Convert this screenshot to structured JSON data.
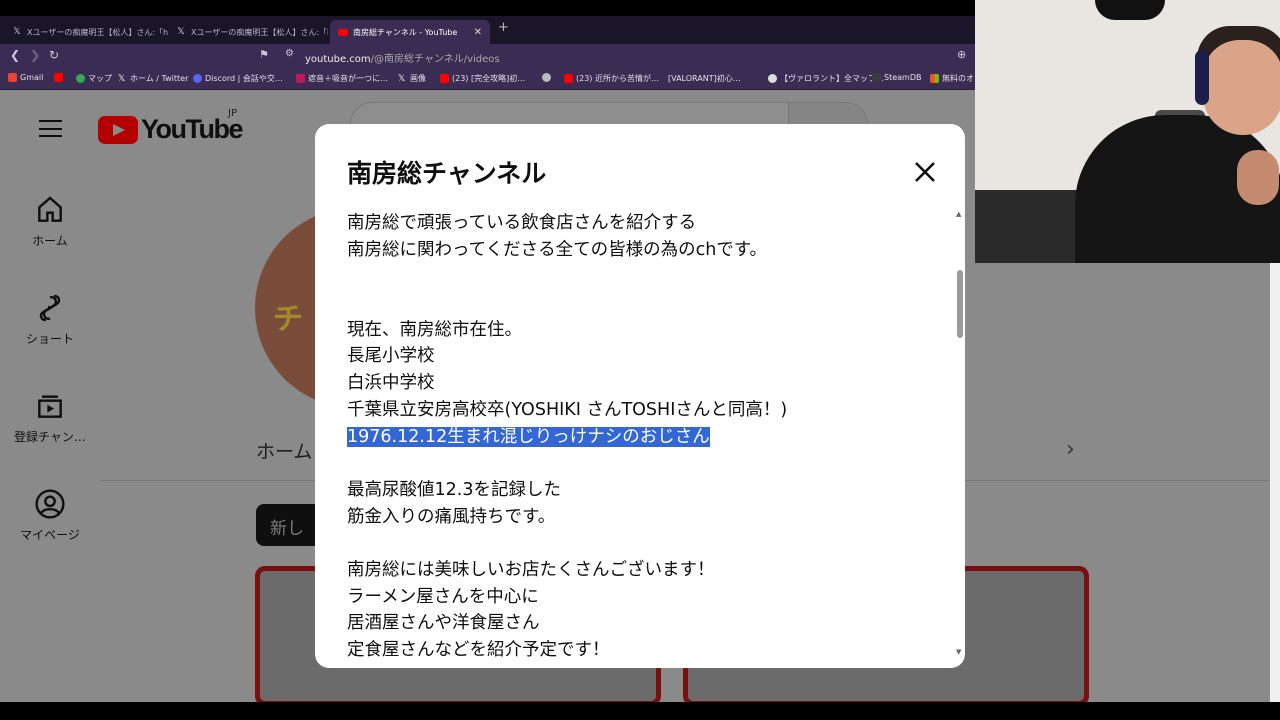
{
  "browser": {
    "tabs": [
      {
        "label": "Xユーザーの痴魔明王【松人】さん:「https:"
      },
      {
        "label": "Xユーザーの痴魔明王【松人】さん:「https:"
      },
      {
        "label": "南房総チャンネル - YouTube"
      }
    ],
    "new_tab": "+",
    "url_host": "youtube.com",
    "url_path": "/@南房総チャンネル/videos",
    "bookmarks": [
      {
        "label": "Gmail"
      },
      {
        "label": ""
      },
      {
        "label": "マップ"
      },
      {
        "label": "ホーム / Twitter"
      },
      {
        "label": "Discord | 会話や交…"
      },
      {
        "label": "遮音＋吸音が一つに…"
      },
      {
        "label": "画像"
      },
      {
        "label": "(23) [完全攻略]初…"
      },
      {
        "label": ""
      },
      {
        "label": "(23) 近所から苦情が…"
      },
      {
        "label": "[VALORANT]初心…"
      },
      {
        "label": "【ヴァロラント】全マップ…"
      },
      {
        "label": "SteamDB"
      },
      {
        "label": "無料のオ"
      }
    ]
  },
  "youtube": {
    "logo_text": "YouTube",
    "region": "JP",
    "sidebar": [
      {
        "label": "ホーム"
      },
      {
        "label": "ショート"
      },
      {
        "label": "登録チャン…"
      },
      {
        "label": "マイページ"
      }
    ],
    "channel_tab_home": "ホーム",
    "chip_new": "新し",
    "avatar_text": "チ"
  },
  "modal": {
    "title": "南房総チャンネル",
    "lines": [
      "南房総で頑張っている飲食店さんを紹介する",
      "南房総に関わってくださる全ての皆様の為のchです。",
      "",
      "",
      "現在、南房総市在住。",
      "長尾小学校",
      "白浜中学校",
      "千葉県立安房高校卒(YOSHIKI さんTOSHIさんと同高！)",
      "1976.12.12生まれ混じりっけナシのおじさん",
      "",
      "最高尿酸値12.3を記録した",
      "筋金入りの痛風持ちです。",
      "",
      "南房総には美味しいお店たくさんございます！",
      "ラーメン屋さんを中心に",
      "居酒屋さんや洋食屋さん",
      "定食屋さんなどを紹介予定です！"
    ],
    "highlighted_line_index": 8
  }
}
